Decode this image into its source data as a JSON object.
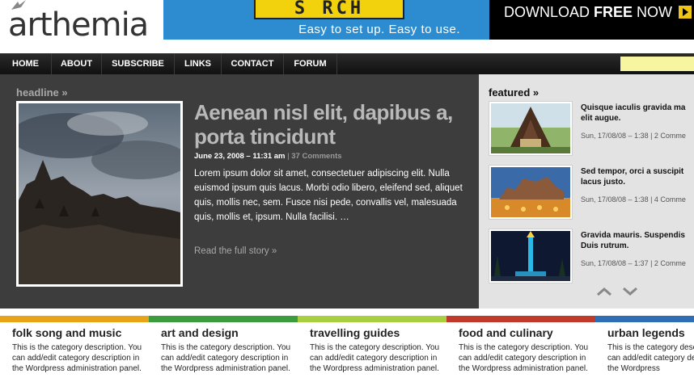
{
  "header": {
    "logo_text": "arthemia"
  },
  "banner": {
    "search_word": "S  RCH",
    "tagline": "Easy to set up.  Easy to use.",
    "download_pre": "DOWNLOAD ",
    "download_bold": "FREE",
    "download_post": " NOW"
  },
  "nav": {
    "items": [
      "HOME",
      "ABOUT",
      "SUBSCRIBE",
      "LINKS",
      "CONTACT",
      "FORUM"
    ]
  },
  "headline": {
    "label": "headline »",
    "title": "Aenean nisl elit, dapibus a, porta tincidunt",
    "date": "June 23, 2008 – 11:31 am",
    "separator": " | ",
    "comments": "37 Comments",
    "excerpt": "Lorem ipsum dolor sit amet, consectetuer adipiscing elit. Nulla euismod ipsum quis lacus. Morbi odio libero, eleifend sed, aliquet quis, mollis nec, sem. Fusce nisi pede, convallis vel, malesuada quis, mollis et, ipsum. Nulla facilisi. …",
    "read_more": "Read the full story »"
  },
  "featured": {
    "label": "featured »",
    "items": [
      {
        "title_l1": "Quisque iaculis gravida ma",
        "title_l2": "elit augue.",
        "meta": "Sun, 17/08/08 – 1:38 | 2 Comme"
      },
      {
        "title_l1": "Sed tempor, orci a suscipit",
        "title_l2": "lacus justo.",
        "meta": "Sun, 17/08/08 – 1:38 | 4 Comme"
      },
      {
        "title_l1": "Gravida mauris. Suspendis",
        "title_l2": "Duis rutrum.",
        "meta": "Sun, 17/08/08 – 1:37 | 2 Comme"
      }
    ]
  },
  "categories": [
    {
      "title": "folk song and music",
      "desc": "This is the category description. You can add/edit category description in the Wordpress administration panel.",
      "color": "#e8a317"
    },
    {
      "title": "art and design",
      "desc": "This is the category description. You can add/edit category description in the Wordpress administration panel.",
      "color": "#3c9b3c"
    },
    {
      "title": "travelling guides",
      "desc": "This is the category description. You can add/edit category description in the Wordpress administration panel.",
      "color": "#a8cf3f"
    },
    {
      "title": "food and culinary",
      "desc": "This is the category description. You can add/edit category description in the Wordpress administration panel.",
      "color": "#c0392b"
    },
    {
      "title": "urban legends",
      "desc": "This is the category description. You can add/edit category description in the Wordpress",
      "color": "#2f6db5"
    }
  ],
  "colors": {
    "nav_bg": "#1a1a1a",
    "headline_bg": "#3d3d3d",
    "featured_bg": "#e3e3e3",
    "search_field": "#f7f5a0"
  },
  "icons": {
    "arrow_up": "chevron-up-icon",
    "arrow_down": "chevron-down-icon",
    "download_arrow": "play-arrow-icon"
  }
}
